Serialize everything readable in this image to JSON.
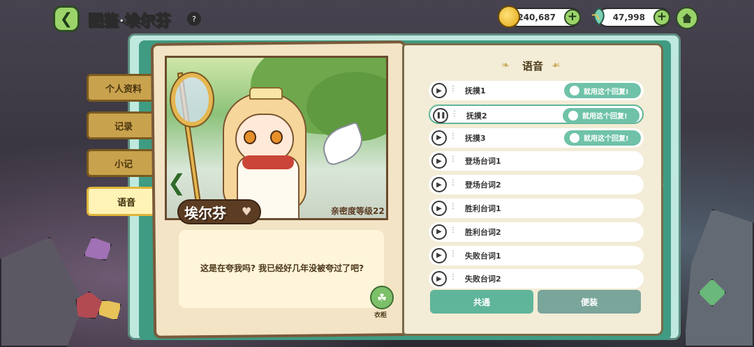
{
  "header": {
    "title": "图鉴·埃尔芬",
    "back_icon": "chevron-left-icon",
    "book_icon": "book-icon"
  },
  "currencies": {
    "gold": {
      "value": "240,687",
      "icon": "gold-coin-icon"
    },
    "leaf": {
      "value": "47,998",
      "icon": "leaf-crystal-icon"
    }
  },
  "side_tabs": [
    {
      "label": "个人资料",
      "active": false
    },
    {
      "label": "记录",
      "active": false
    },
    {
      "label": "小记",
      "active": false
    },
    {
      "label": "语音",
      "active": true
    }
  ],
  "character": {
    "name": "埃尔芬",
    "affinity_text": "亲密度等级22",
    "quote": "这是在夸我吗? 我已经好几年没被夸过了吧?",
    "wardrobe_label": "衣柜"
  },
  "voice_panel": {
    "title": "语音",
    "items": [
      {
        "label": "抚摸1",
        "state": "idle",
        "has_use_toggle": true
      },
      {
        "label": "抚摸2",
        "state": "playing",
        "has_use_toggle": true
      },
      {
        "label": "抚摸3",
        "state": "idle",
        "has_use_toggle": true
      },
      {
        "label": "登场台词1",
        "state": "idle",
        "has_use_toggle": false
      },
      {
        "label": "登场台词2",
        "state": "idle",
        "has_use_toggle": false
      },
      {
        "label": "胜利台词1",
        "state": "idle",
        "has_use_toggle": false
      },
      {
        "label": "胜利台词2",
        "state": "idle",
        "has_use_toggle": false
      },
      {
        "label": "失败台词1",
        "state": "idle",
        "has_use_toggle": false
      },
      {
        "label": "失败台词2",
        "state": "idle",
        "has_use_toggle": false
      }
    ],
    "use_label": "就用这个回复!",
    "tabs": [
      {
        "label": "共通",
        "active": true
      },
      {
        "label": "便装",
        "active": false
      }
    ]
  },
  "colors": {
    "accent_green": "#6fc2a8",
    "active_tab_green": "#5fb59a",
    "inactive_tab_gray": "#7aa59a",
    "button_green": "#9bd36a"
  }
}
